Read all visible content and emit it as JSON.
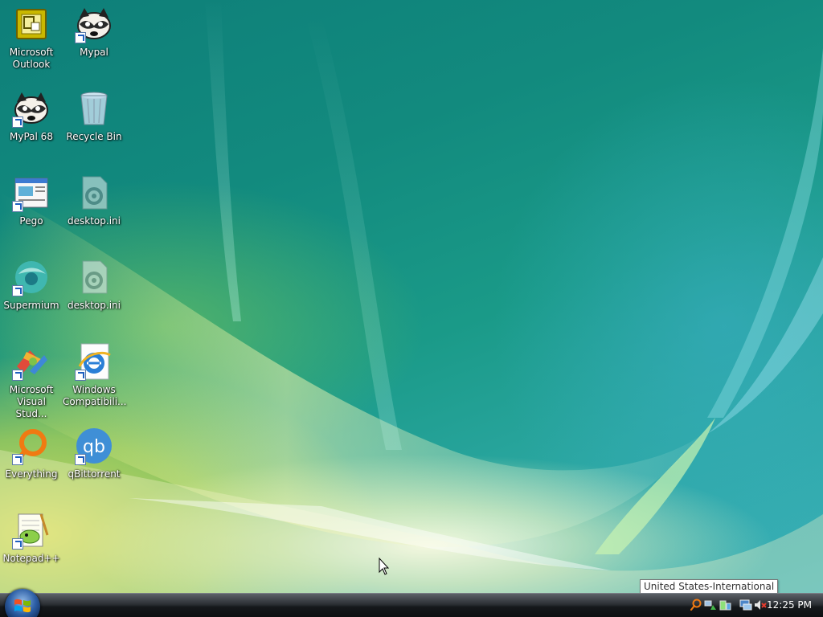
{
  "desktop_icons": [
    {
      "id": "outlook",
      "label": "Microsoft\nOutlook",
      "icon": "outlook-icon",
      "shortcut": false
    },
    {
      "id": "mypal",
      "label": "Mypal",
      "icon": "raccoon-icon",
      "shortcut": true
    },
    {
      "id": "mypal68",
      "label": "MyPal 68",
      "icon": "raccoon-icon",
      "shortcut": true
    },
    {
      "id": "recycle",
      "label": "Recycle Bin",
      "icon": "recycle-bin-icon",
      "shortcut": false
    },
    {
      "id": "pego",
      "label": "Pego",
      "icon": "window-document-icon",
      "shortcut": true
    },
    {
      "id": "desktopini1",
      "label": "desktop.ini",
      "icon": "settings-file-icon",
      "shortcut": false
    },
    {
      "id": "supermium",
      "label": "Supermium",
      "icon": "globe-icon",
      "shortcut": true
    },
    {
      "id": "desktopini2",
      "label": "desktop.ini",
      "icon": "settings-file-icon",
      "shortcut": false
    },
    {
      "id": "visualstudio",
      "label": "Microsoft\nVisual Stud...",
      "icon": "visual-studio-icon",
      "shortcut": true
    },
    {
      "id": "wincompat",
      "label": "Windows\nCompatibili...",
      "icon": "internet-explorer-icon",
      "shortcut": true
    },
    {
      "id": "everything",
      "label": "Everything",
      "icon": "search-icon",
      "shortcut": true
    },
    {
      "id": "qbittorrent",
      "label": "qBittorrent",
      "icon": "qbittorrent-icon",
      "shortcut": true
    },
    {
      "id": "notepadpp",
      "label": "Notepad++",
      "icon": "notepad-plus-plus-icon",
      "shortcut": true
    }
  ],
  "tooltip": "United States-International",
  "taskbar": {
    "start_icon": "windows-logo-icon",
    "tray_icons": [
      "search-tray-icon",
      "network-tray-icon",
      "battery-tray-icon",
      "monitor-tray-icon",
      "volume-muted-icon"
    ],
    "clock": "12:25 PM"
  }
}
